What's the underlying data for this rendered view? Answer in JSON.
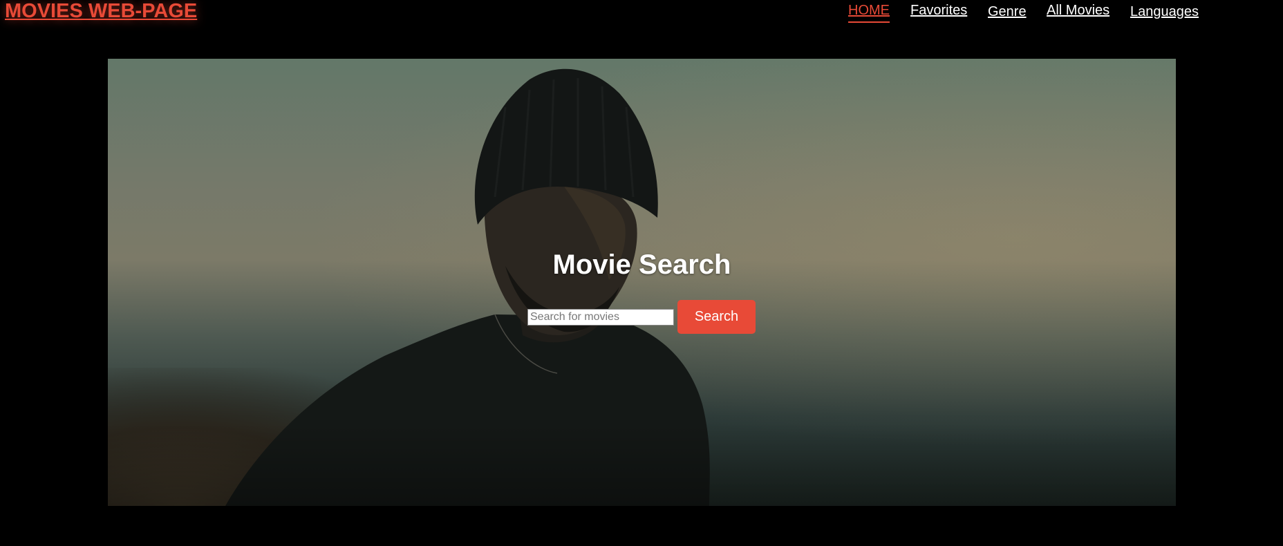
{
  "header": {
    "brand": "MOVIES WEB-PAGE",
    "nav": [
      {
        "label": "HOME",
        "active": true
      },
      {
        "label": "Favorites",
        "active": false
      },
      {
        "label": "Genre",
        "active": false
      },
      {
        "label": "All Movies",
        "active": false
      },
      {
        "label": "Languages",
        "active": false
      }
    ]
  },
  "hero": {
    "title": "Movie Search",
    "search": {
      "placeholder": "Search for movies",
      "value": "",
      "button_label": "Search"
    }
  },
  "colors": {
    "accent": "#e84a37",
    "background": "#000000",
    "nav_text": "#ffffff"
  }
}
